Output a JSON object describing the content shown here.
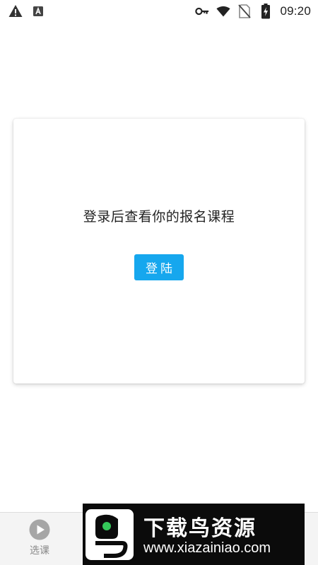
{
  "status_bar": {
    "time": "09:20",
    "left_icons": [
      "warning-icon",
      "app-a-icon"
    ],
    "right_icons": [
      "key-icon",
      "wifi-icon",
      "no-sim-icon",
      "battery-charging-icon"
    ]
  },
  "card": {
    "message": "登录后查看你的报名课程",
    "login_label": "登陆"
  },
  "bottom_nav": {
    "items": [
      {
        "label": "选课",
        "icon": "play-circle-icon"
      }
    ]
  },
  "watermark": {
    "title": "下载鸟资源",
    "url": "www.xiazainiao.com"
  },
  "colors": {
    "accent": "#16a7ee",
    "nav_inactive": "#888888",
    "nav_background": "#f4f4f4",
    "watermark_background": "#0b0b0b",
    "watermark_green": "#34c759"
  }
}
